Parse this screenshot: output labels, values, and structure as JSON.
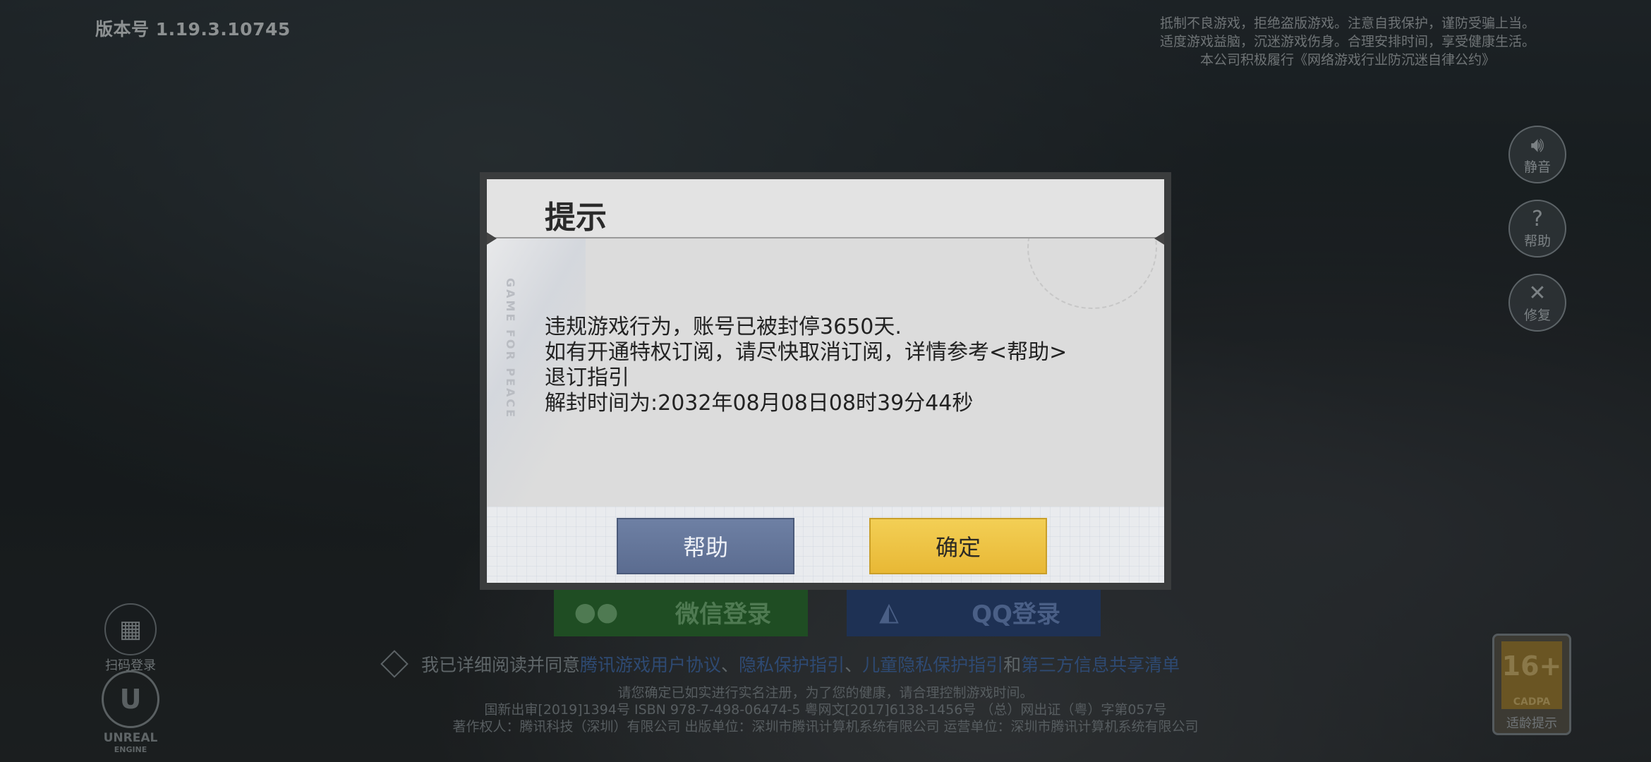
{
  "version_label": "版本号 1.19.3.10745",
  "health_notice": [
    "抵制不良游戏，拒绝盗版游戏。注意自我保护，谨防受骗上当。",
    "适度游戏益脑，沉迷游戏伤身。合理安排时间，享受健康生活。",
    "本公司积极履行《网络游戏行业防沉迷自律公约》"
  ],
  "side_buttons": [
    {
      "label": "静音",
      "icon": "speaker-icon"
    },
    {
      "label": "帮助",
      "icon": "question-icon"
    },
    {
      "label": "修复",
      "icon": "wrench-icon"
    }
  ],
  "qr_login_label": "扫码登录",
  "engine_logo": {
    "label": "UNREAL",
    "sub": "ENGINE"
  },
  "login": {
    "wechat": "微信登录",
    "qq": "QQ登录"
  },
  "agreement": {
    "prefix": "我已详细阅读并同意",
    "links": [
      "腾讯游戏用户协议",
      "隐私保护指引",
      "儿童隐私保护指引"
    ],
    "sep": "、",
    "and": "和",
    "last_link": "第三方信息共享清单"
  },
  "footer": [
    "请您确定已如实进行实名注册，为了您的健康，请合理控制游戏时间。",
    "国新出审[2019]1394号  ISBN 978-7-498-06474-5  粤网文[2017]6138-1456号 （总）网出证（粤）字第057号",
    "著作权人：腾讯科技（深圳）有限公司  出版单位：深圳市腾讯计算机系统有限公司  运营单位：深圳市腾讯计算机系统有限公司"
  ],
  "age_rating": {
    "age": "16+",
    "org": "CADPA",
    "label": "适龄提示"
  },
  "dialog": {
    "title": "提示",
    "deco_text": "GAME FOR PEACE",
    "lines": [
      "违规游戏行为，账号已被封停3650天.",
      "如有开通特权订阅，请尽快取消订阅，详情参考<帮助>",
      "退订指引",
      "解封时间为:2032年08月08日08时39分44秒"
    ],
    "help_button": "帮助",
    "confirm_button": "确定"
  }
}
